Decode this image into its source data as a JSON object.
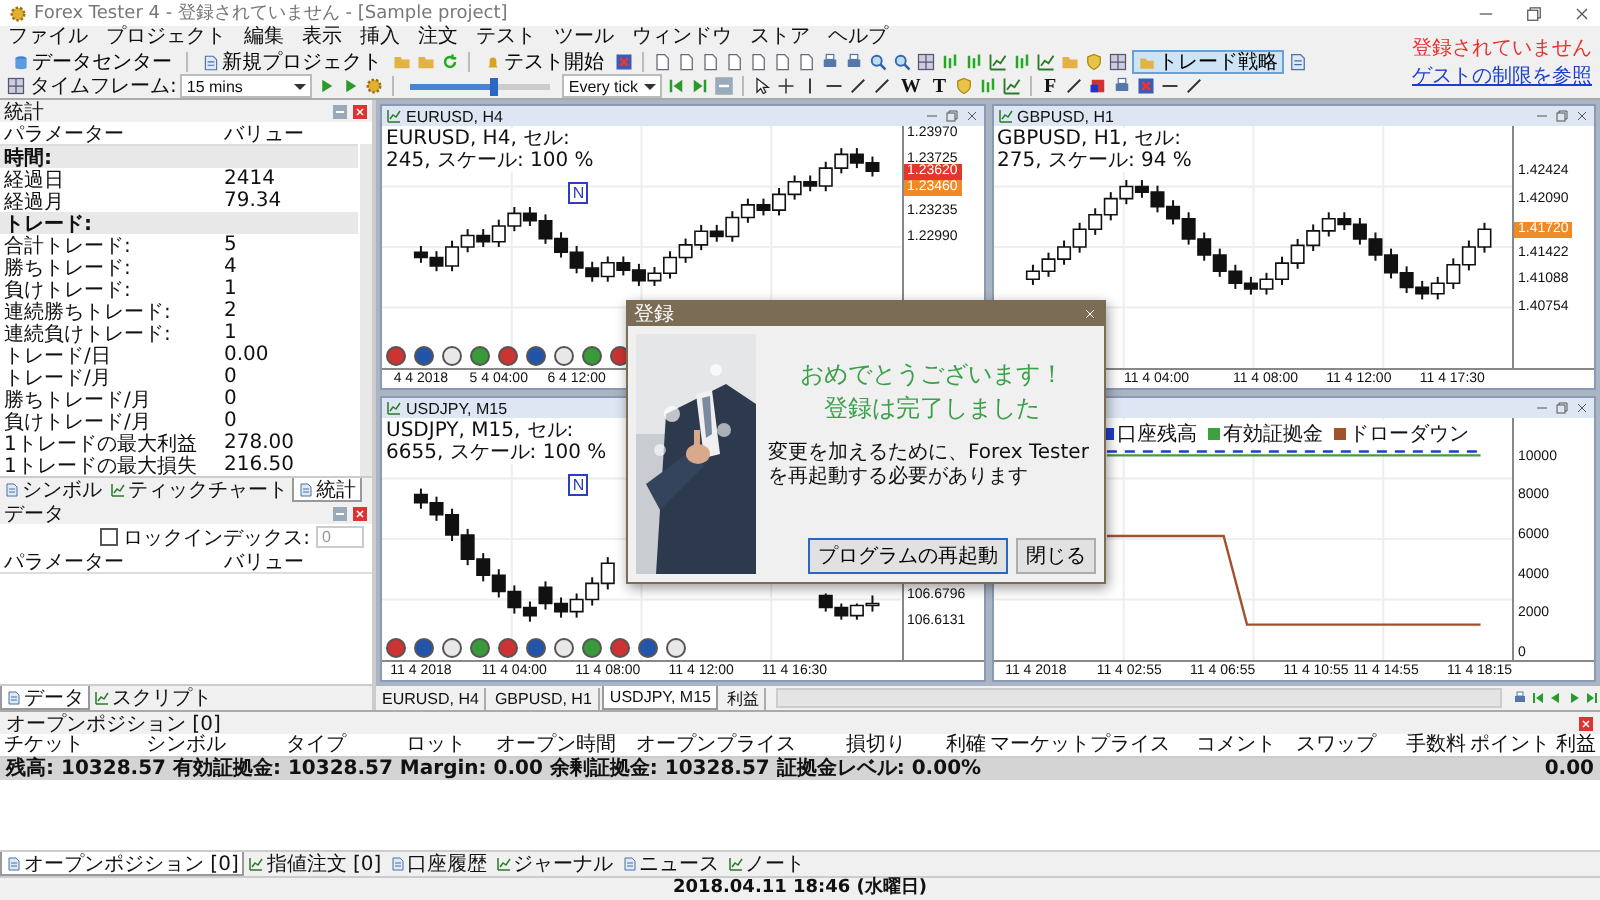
{
  "window": {
    "title": "Forex Tester 4 - 登録されていません - [Sample project]"
  },
  "menu": [
    "ファイル",
    "プロジェクト",
    "編集",
    "表示",
    "挿入",
    "注文",
    "テスト",
    "ツール",
    "ウィンドウ",
    "ストア",
    "ヘルプ"
  ],
  "registration": {
    "status": "登録されていません",
    "link": "ゲストの制限を参照"
  },
  "toolbar_main": {
    "data_center": "データセンター",
    "new_project": "新規プロジェクト",
    "start_test": "テスト開始",
    "trade_strategy": "トレード戦略"
  },
  "toolbar_test": {
    "timeframe_label": "タイムフレーム:",
    "timeframe": "15 mins",
    "speed_slider": {
      "level": 0.6
    },
    "tick_mode": "Every tick",
    "tool_glyphs": [
      "W",
      "T",
      "F"
    ]
  },
  "statistics": {
    "title": "統計",
    "columns": [
      "パラメーター",
      "バリュー"
    ],
    "rows": [
      {
        "kind": "section",
        "label": "時間:"
      },
      {
        "kind": "item",
        "label": "経過日",
        "value": "2414"
      },
      {
        "kind": "item",
        "label": "経過月",
        "value": "79.34"
      },
      {
        "kind": "section",
        "label": "トレード:"
      },
      {
        "kind": "item",
        "label": "合計トレード:",
        "value": "5"
      },
      {
        "kind": "item",
        "label": "勝ちトレード:",
        "value": "4"
      },
      {
        "kind": "item",
        "label": "負けトレード:",
        "value": "1"
      },
      {
        "kind": "item",
        "label": "連続勝ちトレード:",
        "value": "2"
      },
      {
        "kind": "item",
        "label": "連続負けトレード:",
        "value": "1"
      },
      {
        "kind": "item",
        "label": "トレード/日",
        "value": "0.00"
      },
      {
        "kind": "item",
        "label": "トレード/月",
        "value": "0"
      },
      {
        "kind": "item",
        "label": "勝ちトレード/月",
        "value": "0"
      },
      {
        "kind": "item",
        "label": "負けトレード/月",
        "value": "0"
      },
      {
        "kind": "item",
        "label": "1トレードの最大利益",
        "value": "278.00"
      },
      {
        "kind": "item",
        "label": "1トレードの最大損失",
        "value": "216.50"
      }
    ]
  },
  "left_tabs_top": [
    {
      "label": "シンボル",
      "selected": false
    },
    {
      "label": "ティックチャート",
      "selected": false
    },
    {
      "label": "統計",
      "selected": true
    }
  ],
  "data_panel": {
    "title": "データ",
    "lock_index": {
      "label": "ロックインデックス:",
      "checked": false
    },
    "index_value": "0",
    "columns": [
      "パラメーター",
      "バリュー"
    ]
  },
  "left_tabs_bottom": [
    {
      "label": "データ",
      "selected": true
    },
    {
      "label": "スクリプト",
      "selected": false
    }
  ],
  "charts": [
    {
      "title": "EURUSD, H4",
      "info": "EURUSD, H4, セル: 245, スケール: 100 %",
      "marker": "N",
      "chart_data": {
        "type": "candlestick",
        "categories": [
          "4 4 2018",
          null,
          null,
          null,
          null,
          "5 4 04:00",
          null,
          null,
          null,
          null,
          "6 4 12:00",
          null,
          null,
          null,
          null,
          null,
          null,
          null,
          null,
          null,
          null,
          null,
          null,
          null,
          null,
          null,
          null,
          null,
          null,
          null
        ],
        "ylim": [
          1.2175,
          1.2405
        ],
        "grid": true,
        "ohlc": [
          [
            1.2285,
            1.2291,
            1.2275,
            1.228
          ],
          [
            1.228,
            1.2286,
            1.2267,
            1.2272
          ],
          [
            1.2272,
            1.2296,
            1.2267,
            1.229
          ],
          [
            1.229,
            1.2307,
            1.2285,
            1.2301
          ],
          [
            1.2301,
            1.2307,
            1.229,
            1.2295
          ],
          [
            1.2295,
            1.2316,
            1.229,
            1.231
          ],
          [
            1.231,
            1.2328,
            1.2305,
            1.2322
          ],
          [
            1.2322,
            1.2328,
            1.231,
            1.2315
          ],
          [
            1.2315,
            1.2321,
            1.2293,
            1.2298
          ],
          [
            1.2298,
            1.2304,
            1.228,
            1.2285
          ],
          [
            1.2285,
            1.2291,
            1.2265,
            1.227
          ],
          [
            1.227,
            1.2276,
            1.2257,
            1.2262
          ],
          [
            1.2262,
            1.2281,
            1.2257,
            1.2275
          ],
          [
            1.2275,
            1.2281,
            1.2263,
            1.2268
          ],
          [
            1.2268,
            1.2274,
            1.2253,
            1.2258
          ],
          [
            1.2258,
            1.2271,
            1.2253,
            1.2265
          ],
          [
            1.2265,
            1.2286,
            1.226,
            1.228
          ],
          [
            1.228,
            1.2298,
            1.2275,
            1.2292
          ],
          [
            1.2292,
            1.2311,
            1.2287,
            1.2305
          ],
          [
            1.2305,
            1.2311,
            1.2295,
            1.23
          ],
          [
            1.23,
            1.2324,
            1.2295,
            1.2318
          ],
          [
            1.2318,
            1.2336,
            1.2313,
            1.233
          ],
          [
            1.233,
            1.2336,
            1.232,
            1.2325
          ],
          [
            1.2325,
            1.2346,
            1.232,
            1.234
          ],
          [
            1.234,
            1.2358,
            1.2335,
            1.2352
          ],
          [
            1.2352,
            1.2358,
            1.2343,
            1.2348
          ],
          [
            1.2348,
            1.2371,
            1.2343,
            1.2365
          ],
          [
            1.2365,
            1.2384,
            1.236,
            1.2378
          ],
          [
            1.2378,
            1.2384,
            1.2365,
            1.237
          ],
          [
            1.237,
            1.2376,
            1.2357,
            1.2362
          ]
        ],
        "yticks": [
          {
            "value": 1.2397,
            "label": "1.23970"
          },
          {
            "value": 1.23725,
            "label": "1.23725"
          },
          {
            "value": 1.23235,
            "label": "1.23235"
          },
          {
            "value": 1.2299,
            "label": "1.22990"
          }
        ]
      },
      "price_tags": [
        {
          "text": "1.23620",
          "color": "#e0382c"
        },
        {
          "text": "1.23460",
          "color": "#f08a24"
        }
      ]
    },
    {
      "title": "GBPUSD, H1",
      "info": "GBPUSD, H1, セル: 275, スケール: 94 %",
      "chart_data": {
        "type": "candlestick",
        "categories": [
          null,
          null,
          null,
          null,
          null,
          null,
          null,
          null,
          "11 4 04:00",
          null,
          null,
          null,
          null,
          null,
          null,
          "11 4 08:00",
          null,
          null,
          null,
          null,
          null,
          "11 4 12:00",
          null,
          null,
          null,
          null,
          null,
          "11 4 17:30",
          null,
          null
        ],
        "ylim": [
          1.4,
          1.43
        ],
        "grid": true,
        "ohlc": [
          [
            1.411,
            1.4128,
            1.4103,
            1.412
          ],
          [
            1.412,
            1.4143,
            1.4113,
            1.4135
          ],
          [
            1.4135,
            1.4158,
            1.4128,
            1.415
          ],
          [
            1.415,
            1.418,
            1.4143,
            1.4172
          ],
          [
            1.4172,
            1.4198,
            1.4165,
            1.419
          ],
          [
            1.419,
            1.4218,
            1.4183,
            1.421
          ],
          [
            1.421,
            1.4233,
            1.4203,
            1.4225
          ],
          [
            1.4225,
            1.4233,
            1.4211,
            1.4218
          ],
          [
            1.4218,
            1.4226,
            1.4193,
            1.42
          ],
          [
            1.42,
            1.4208,
            1.4178,
            1.4185
          ],
          [
            1.4185,
            1.4193,
            1.4153,
            1.416
          ],
          [
            1.416,
            1.4168,
            1.4133,
            1.414
          ],
          [
            1.414,
            1.4148,
            1.4113,
            1.412
          ],
          [
            1.412,
            1.4128,
            1.4098,
            1.4105
          ],
          [
            1.4105,
            1.4113,
            1.4091,
            1.4098
          ],
          [
            1.4098,
            1.4118,
            1.4091,
            1.411
          ],
          [
            1.411,
            1.4138,
            1.4103,
            1.413
          ],
          [
            1.413,
            1.416,
            1.4123,
            1.4152
          ],
          [
            1.4152,
            1.4178,
            1.4145,
            1.417
          ],
          [
            1.417,
            1.4193,
            1.4163,
            1.4185
          ],
          [
            1.4185,
            1.4193,
            1.4171,
            1.4178
          ],
          [
            1.4178,
            1.4186,
            1.4153,
            1.416
          ],
          [
            1.416,
            1.4168,
            1.4133,
            1.414
          ],
          [
            1.414,
            1.4148,
            1.4111,
            1.4118
          ],
          [
            1.4118,
            1.4126,
            1.4093,
            1.41
          ],
          [
            1.41,
            1.4108,
            1.4085,
            1.4092
          ],
          [
            1.4092,
            1.4113,
            1.4085,
            1.4105
          ],
          [
            1.4105,
            1.4136,
            1.4098,
            1.4128
          ],
          [
            1.4128,
            1.4158,
            1.4121,
            1.415
          ],
          [
            1.415,
            1.418,
            1.4143,
            1.4172
          ]
        ],
        "yticks": [
          {
            "value": 1.42424,
            "label": "1.42424"
          },
          {
            "value": 1.4209,
            "label": "1.42090"
          },
          {
            "value": 1.41422,
            "label": "1.41422"
          },
          {
            "value": 1.41088,
            "label": "1.41088"
          },
          {
            "value": 1.40754,
            "label": "1.40754"
          }
        ]
      },
      "price_tags": [
        {
          "text": "1.41720",
          "color": "#f08a24"
        }
      ]
    },
    {
      "title": "USDJPY, M15",
      "info": "USDJPY, M15, セル: 6655, スケール: 100 %",
      "marker": "N",
      "chart_data": {
        "type": "candlestick",
        "categories": [
          "11 4 2018",
          null,
          null,
          null,
          null,
          null,
          "11 4 04:00",
          null,
          null,
          null,
          null,
          null,
          "11 4 08:00",
          null,
          null,
          null,
          null,
          null,
          "11 4 12:00",
          null,
          null,
          null,
          null,
          null,
          "11 4 16:30",
          null,
          null,
          null,
          null,
          null
        ],
        "ylim": [
          106.52,
          107.12
        ],
        "grid": true,
        "ohlc": [
          [
            106.93,
            106.945,
            106.895,
            106.91
          ],
          [
            106.91,
            106.925,
            106.865,
            106.88
          ],
          [
            106.88,
            106.895,
            106.815,
            106.83
          ],
          [
            106.83,
            106.845,
            106.755,
            106.77
          ],
          [
            106.77,
            106.785,
            106.715,
            106.73
          ],
          [
            106.73,
            106.745,
            106.675,
            106.69
          ],
          [
            106.69,
            106.705,
            106.635,
            106.65
          ],
          [
            106.65,
            106.665,
            106.615,
            106.63
          ],
          [
            106.7,
            106.715,
            106.645,
            106.66
          ],
          [
            106.66,
            106.675,
            106.625,
            106.64
          ],
          [
            106.64,
            106.685,
            106.625,
            106.67
          ],
          [
            106.67,
            106.725,
            106.655,
            106.71
          ],
          [
            106.71,
            106.775,
            106.695,
            106.76
          ],
          null,
          null,
          null,
          null,
          null,
          null,
          null,
          null,
          null,
          null,
          null,
          null,
          null,
          [
            106.68,
            106.685,
            106.64,
            106.65
          ],
          [
            106.65,
            106.66,
            106.62,
            106.63
          ],
          [
            106.63,
            106.66,
            106.62,
            106.655
          ],
          [
            106.655,
            106.68,
            106.64,
            106.66
          ]
        ],
        "yticks": [
          {
            "value": 106.6796,
            "label": "106.6796"
          },
          {
            "value": 106.6131,
            "label": "106.6131"
          }
        ]
      }
    },
    {
      "chart_data": {
        "type": "line",
        "categories": [
          "11 4 2018",
          null,
          null,
          null,
          "11 4 02:55",
          null,
          null,
          null,
          "11 4 06:55",
          null,
          null,
          null,
          "11 4 10:55",
          null,
          null,
          "11 4 14:55",
          null,
          null,
          null,
          "11 4 18:15"
        ],
        "ylim": [
          -300,
          12000
        ],
        "grid": true,
        "legend": "top",
        "series": [
          {
            "name": "口座残高",
            "color": "#1f3fd0",
            "line_style": "dashed",
            "values": [
              null,
              null,
              null,
              10300,
              10300,
              10300,
              10300,
              10300,
              10300,
              10300,
              10300,
              10300,
              10300,
              10300,
              10300,
              10300,
              10300,
              10300,
              10300,
              10300
            ]
          },
          {
            "name": "有効証拠金",
            "color": "#3fa03f",
            "values": [
              null,
              null,
              null,
              10100,
              10100,
              10100,
              10100,
              10100,
              10100,
              10100,
              10100,
              10100,
              10100,
              10100,
              10100,
              10100,
              10100,
              10100,
              10100,
              10100
            ]
          },
          {
            "name": "ドローダウン",
            "color": "#a0522d",
            "values": [
              null,
              null,
              null,
              6000,
              6000,
              6000,
              6000,
              6000,
              6000,
              1500,
              1500,
              1500,
              1500,
              1500,
              1500,
              1500,
              1500,
              1500,
              1500,
              1500
            ]
          }
        ],
        "yticks": [
          10000,
          8000,
          6000,
          4000,
          2000,
          0
        ]
      }
    }
  ],
  "chart_tabs": [
    {
      "label": "EURUSD, H4",
      "selected": false
    },
    {
      "label": "GBPUSD, H1",
      "selected": false
    },
    {
      "label": "USDJPY, M15",
      "selected": true
    },
    {
      "label": "利益",
      "selected": false
    }
  ],
  "dialog": {
    "title": "登録",
    "heading": [
      "おめでとうございます！",
      "登録は完了しました"
    ],
    "message": "変更を加えるために、Forex Testerを再起動する必要があります",
    "buttons": [
      "プログラムの再起動",
      "閉じる"
    ]
  },
  "positions": {
    "title": "オープンポジション [0]",
    "columns": [
      "チケット",
      "シンボル",
      "タイプ",
      "ロット",
      "オープン時間",
      "オープンプライス",
      "損切り",
      "利確",
      "マーケットプライス",
      "コメント",
      "スワップ",
      "手数料",
      "ポイント",
      "利益"
    ],
    "summary": "残高: 10328.57 有効証拠金: 10328.57 Margin: 0.00 余剰証拠金: 10328.57 証拠金レベル: 0.00%",
    "summary_profit": "0.00"
  },
  "bottom_tabs": [
    {
      "label": "オープンポジション [0]",
      "selected": true
    },
    {
      "label": "指値注文 [0]",
      "selected": false
    },
    {
      "label": "口座履歴",
      "selected": false
    },
    {
      "label": "ジャーナル",
      "selected": false
    },
    {
      "label": "ニュース",
      "selected": false
    },
    {
      "label": "ノート",
      "selected": false
    }
  ],
  "status_bar": {
    "datetime": "2018.04.11 18:46 (水曜日)"
  }
}
